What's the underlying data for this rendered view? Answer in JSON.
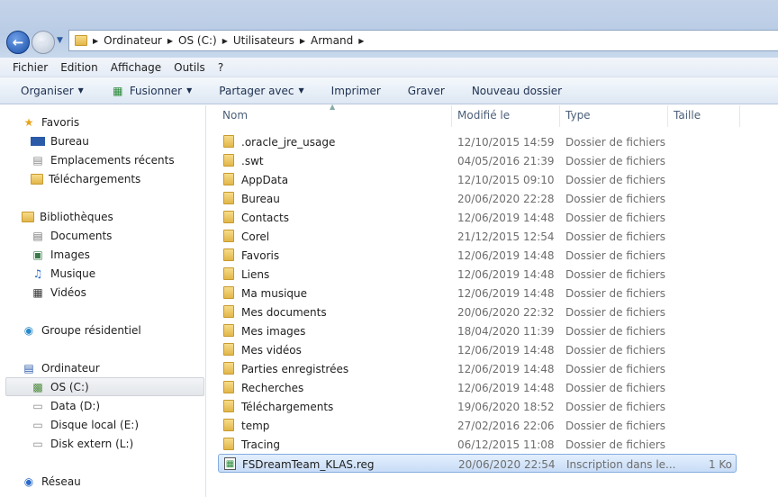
{
  "address": {
    "crumbs": [
      "Ordinateur",
      "OS (C:)",
      "Utilisateurs",
      "Armand"
    ]
  },
  "menu": [
    "Fichier",
    "Edition",
    "Affichage",
    "Outils",
    "?"
  ],
  "toolbar": {
    "organize": "Organiser",
    "merge": "Fusionner",
    "share": "Partager avec",
    "print": "Imprimer",
    "burn": "Graver",
    "new_folder": "Nouveau dossier"
  },
  "nav": {
    "favorites": "Favoris",
    "fav_items": [
      "Bureau",
      "Emplacements récents",
      "Téléchargements"
    ],
    "libraries": "Bibliothèques",
    "lib_items": [
      "Documents",
      "Images",
      "Musique",
      "Vidéos"
    ],
    "homegroup": "Groupe résidentiel",
    "computer": "Ordinateur",
    "drives": [
      "OS (C:)",
      "Data (D:)",
      "Disque local (E:)",
      "Disk extern (L:)"
    ],
    "network": "Réseau"
  },
  "columns": {
    "name": "Nom",
    "modified": "Modifié le",
    "type": "Type",
    "size": "Taille"
  },
  "files": [
    {
      "name": ".oracle_jre_usage",
      "date": "12/10/2015 14:59",
      "type": "Dossier de fichiers",
      "size": ""
    },
    {
      "name": ".swt",
      "date": "04/05/2016 21:39",
      "type": "Dossier de fichiers",
      "size": ""
    },
    {
      "name": "AppData",
      "date": "12/10/2015 09:10",
      "type": "Dossier de fichiers",
      "size": ""
    },
    {
      "name": "Bureau",
      "date": "20/06/2020 22:28",
      "type": "Dossier de fichiers",
      "size": ""
    },
    {
      "name": "Contacts",
      "date": "12/06/2019 14:48",
      "type": "Dossier de fichiers",
      "size": ""
    },
    {
      "name": "Corel",
      "date": "21/12/2015 12:54",
      "type": "Dossier de fichiers",
      "size": ""
    },
    {
      "name": "Favoris",
      "date": "12/06/2019 14:48",
      "type": "Dossier de fichiers",
      "size": ""
    },
    {
      "name": "Liens",
      "date": "12/06/2019 14:48",
      "type": "Dossier de fichiers",
      "size": ""
    },
    {
      "name": "Ma musique",
      "date": "12/06/2019 14:48",
      "type": "Dossier de fichiers",
      "size": ""
    },
    {
      "name": "Mes documents",
      "date": "20/06/2020 22:32",
      "type": "Dossier de fichiers",
      "size": ""
    },
    {
      "name": "Mes images",
      "date": "18/04/2020 11:39",
      "type": "Dossier de fichiers",
      "size": ""
    },
    {
      "name": "Mes vidéos",
      "date": "12/06/2019 14:48",
      "type": "Dossier de fichiers",
      "size": ""
    },
    {
      "name": "Parties enregistrées",
      "date": "12/06/2019 14:48",
      "type": "Dossier de fichiers",
      "size": ""
    },
    {
      "name": "Recherches",
      "date": "12/06/2019 14:48",
      "type": "Dossier de fichiers",
      "size": ""
    },
    {
      "name": "Téléchargements",
      "date": "19/06/2020 18:52",
      "type": "Dossier de fichiers",
      "size": ""
    },
    {
      "name": "temp",
      "date": "27/02/2016 22:06",
      "type": "Dossier de fichiers",
      "size": ""
    },
    {
      "name": "Tracing",
      "date": "06/12/2015 11:08",
      "type": "Dossier de fichiers",
      "size": ""
    },
    {
      "name": "FSDreamTeam_KLAS.reg",
      "date": "20/06/2020 22:54",
      "type": "Inscription dans le...",
      "size": "1 Ko"
    }
  ]
}
